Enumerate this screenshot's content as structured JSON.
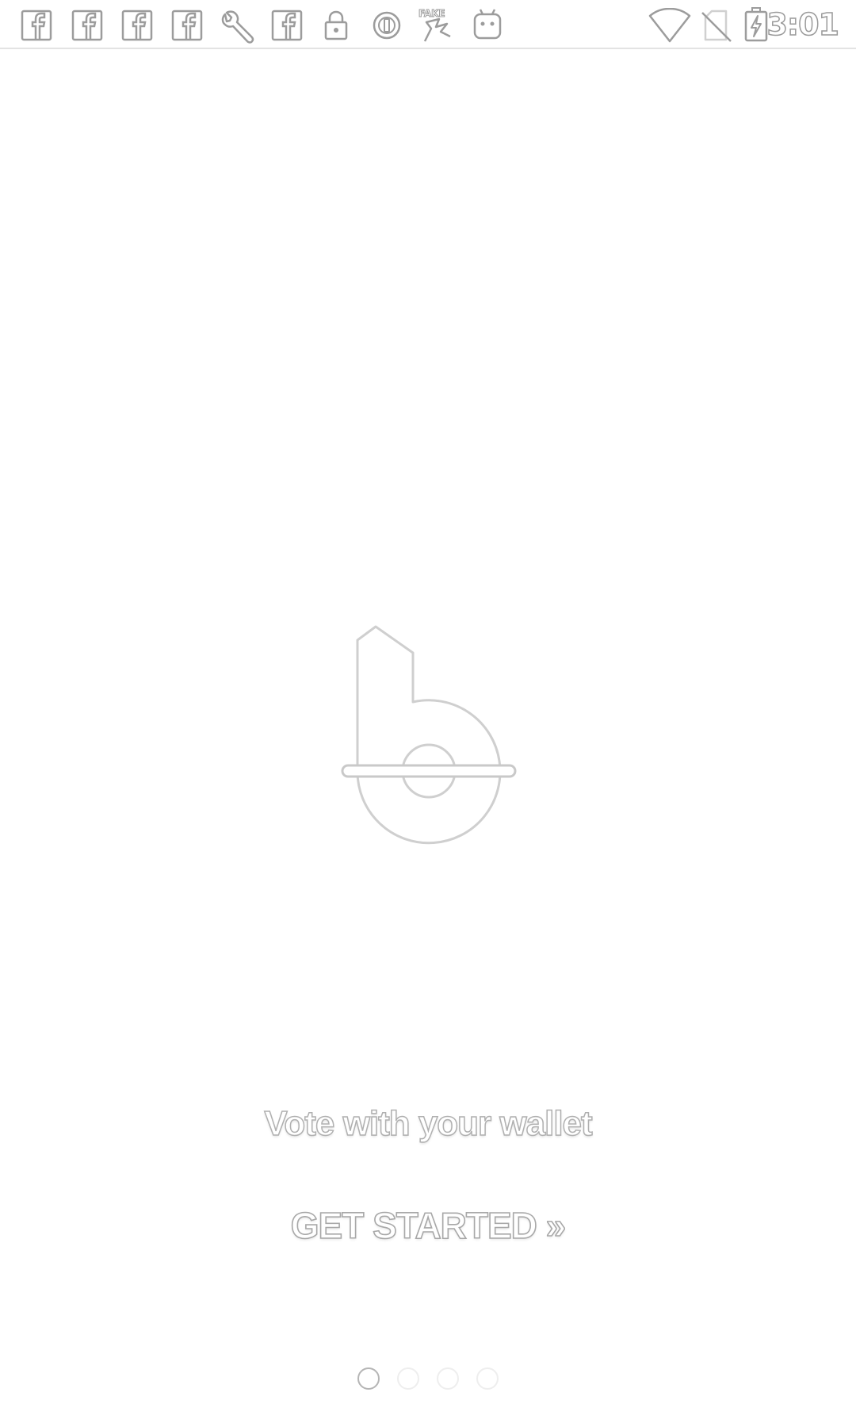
{
  "status_bar": {
    "time": "3:01",
    "notification_icons": [
      "facebook-icon",
      "facebook-icon",
      "facebook-icon",
      "facebook-icon",
      "wrench-icon",
      "facebook-icon",
      "lock-icon",
      "sync-icon",
      "fake-gps-icon",
      "android-icon"
    ],
    "system_icons": [
      "wifi-icon",
      "no-sim-icon",
      "battery-charging-icon"
    ]
  },
  "onboarding": {
    "tagline": "Vote with your wallet",
    "get_started_label": "GET STARTED »",
    "page_indicator": {
      "total": 4,
      "active_index": 0
    }
  }
}
